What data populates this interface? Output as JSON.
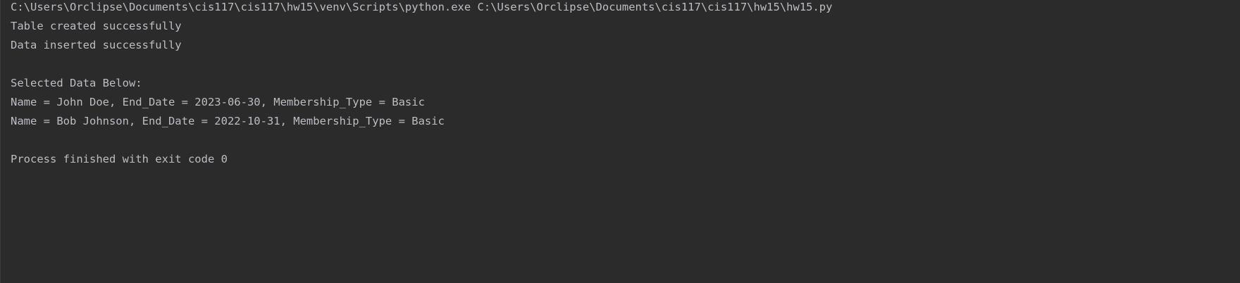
{
  "console": {
    "lines": [
      "C:\\Users\\Orclipse\\Documents\\cis117\\cis117\\hw15\\venv\\Scripts\\python.exe C:\\Users\\Orclipse\\Documents\\cis117\\cis117\\hw15\\hw15.py",
      "Table created successfully",
      "Data inserted successfully",
      "",
      "Selected Data Below:",
      "Name = John Doe, End_Date = 2023-06-30, Membership_Type = Basic",
      "Name = Bob Johnson, End_Date = 2022-10-31, Membership_Type = Basic",
      "",
      "Process finished with exit code 0"
    ]
  },
  "colors": {
    "background": "#2b2b2b",
    "text": "#bcbec4"
  }
}
